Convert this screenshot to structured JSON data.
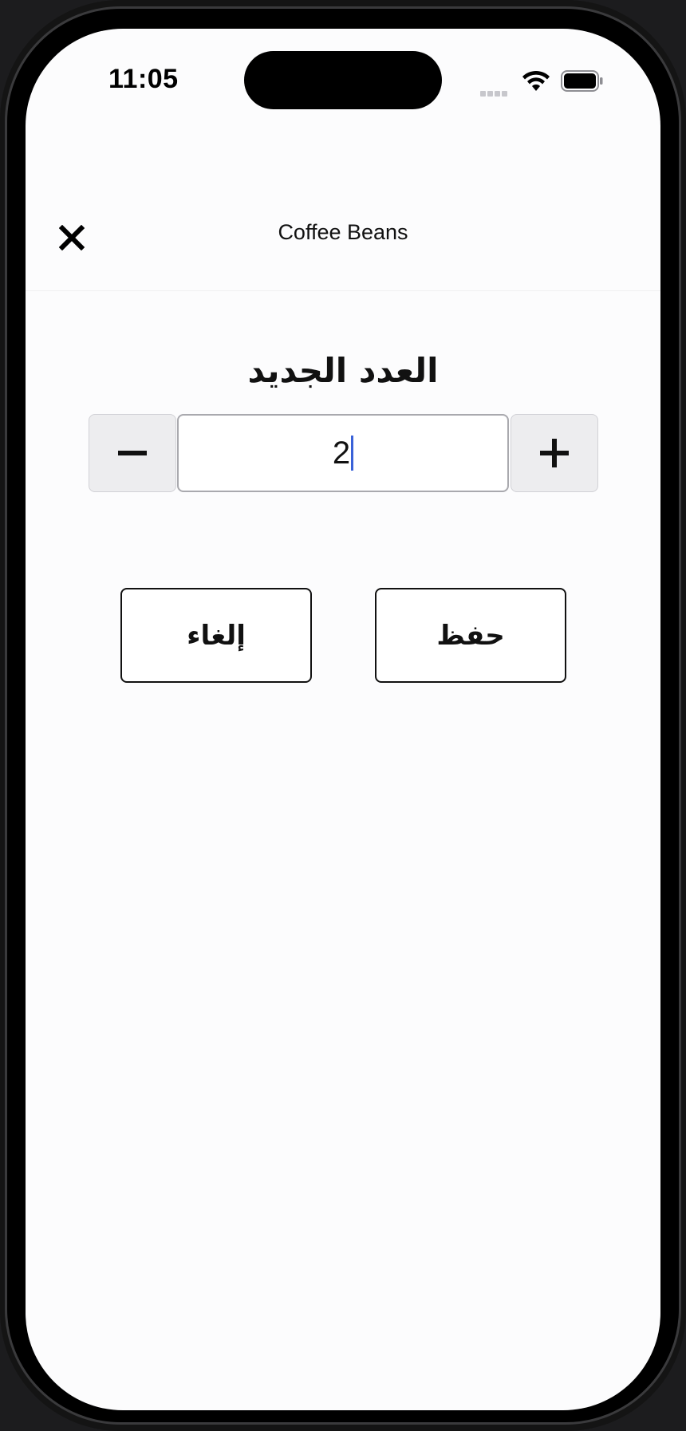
{
  "status_bar": {
    "time": "11:05",
    "icons": [
      "signal-icon",
      "wifi-icon",
      "battery-icon"
    ]
  },
  "nav": {
    "title": "Coffee Beans",
    "close_icon": "close-icon"
  },
  "editor": {
    "heading": "العدد الجديد",
    "quantity_value": "2",
    "decrement_icon": "minus-icon",
    "increment_icon": "plus-icon"
  },
  "actions": {
    "cancel_label": "إلغاء",
    "save_label": "حفظ"
  },
  "colors": {
    "screen_background": "#fcfcfd",
    "stepper_button_background": "#ededef",
    "caret": "#3a62d8",
    "text": "#111111"
  }
}
